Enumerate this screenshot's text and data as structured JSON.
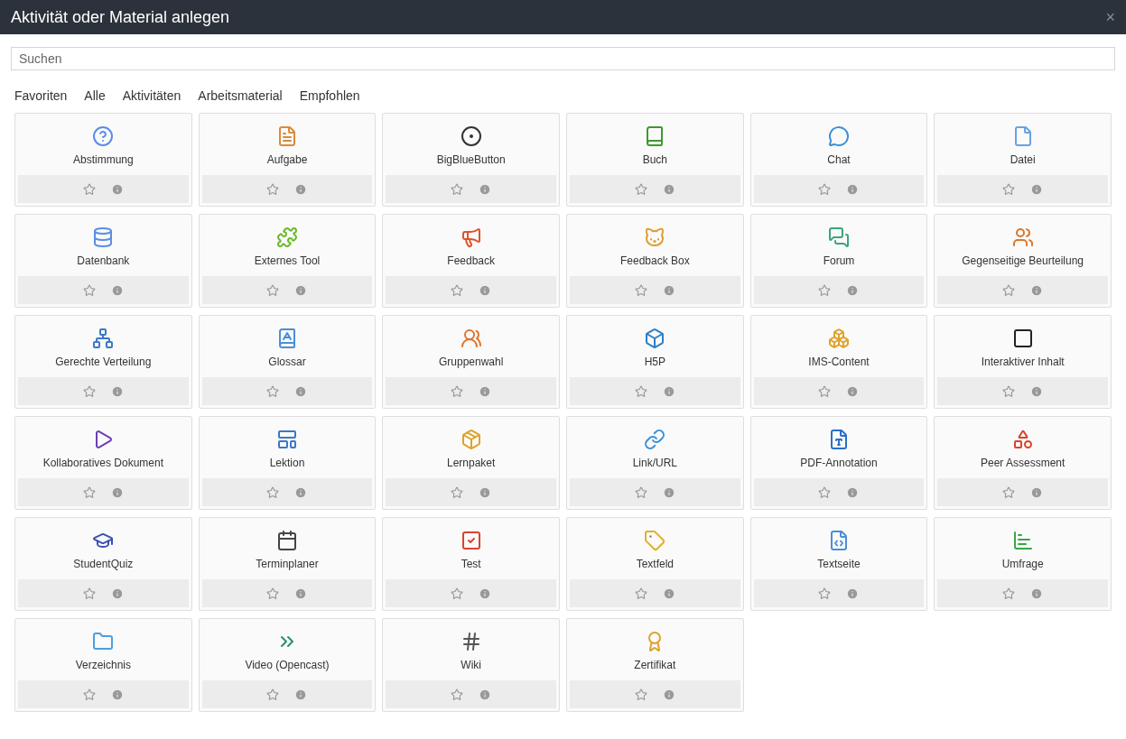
{
  "window": {
    "title": "Aktivität oder Material anlegen",
    "close": "×"
  },
  "search": {
    "placeholder": "Suchen"
  },
  "tabs": [
    {
      "label": "Favoriten"
    },
    {
      "label": "Alle"
    },
    {
      "label": "Aktivitäten"
    },
    {
      "label": "Arbeitsmaterial"
    },
    {
      "label": "Empfohlen"
    }
  ],
  "modules": [
    {
      "name": "Abstimmung",
      "starred": false
    },
    {
      "name": "Aufgabe",
      "starred": false
    },
    {
      "name": "BigBlueButton",
      "starred": false
    },
    {
      "name": "Buch",
      "starred": false
    },
    {
      "name": "Chat",
      "starred": false
    },
    {
      "name": "Datei",
      "starred": false
    },
    {
      "name": "Datenbank",
      "starred": false
    },
    {
      "name": "Externes Tool",
      "starred": false
    },
    {
      "name": "Feedback",
      "starred": false
    },
    {
      "name": "Feedback Box",
      "starred": false
    },
    {
      "name": "Forum",
      "starred": false
    },
    {
      "name": "Gegenseitige Beurteilung",
      "starred": false
    },
    {
      "name": "Gerechte Verteilung",
      "starred": false
    },
    {
      "name": "Glossar",
      "starred": false
    },
    {
      "name": "Gruppenwahl",
      "starred": false
    },
    {
      "name": "H5P",
      "starred": false
    },
    {
      "name": "IMS-Content",
      "starred": false
    },
    {
      "name": "Interaktiver Inhalt",
      "starred": false
    },
    {
      "name": "Kollaboratives Dokument",
      "starred": false
    },
    {
      "name": "Lektion",
      "starred": false
    },
    {
      "name": "Lernpaket",
      "starred": false
    },
    {
      "name": "Link/URL",
      "starred": false
    },
    {
      "name": "PDF-Annotation",
      "starred": false
    },
    {
      "name": "Peer Assessment",
      "starred": false
    },
    {
      "name": "StudentQuiz",
      "starred": false
    },
    {
      "name": "Terminplaner",
      "starred": false
    },
    {
      "name": "Test",
      "starred": false
    },
    {
      "name": "Textfeld",
      "starred": false
    },
    {
      "name": "Textseite",
      "starred": false
    },
    {
      "name": "Umfrage",
      "starred": false
    },
    {
      "name": "Verzeichnis",
      "starred": false
    },
    {
      "name": "Video (Opencast)",
      "starred": false
    },
    {
      "name": "Wiki",
      "starred": false
    },
    {
      "name": "Zertifikat",
      "starred": false
    }
  ]
}
